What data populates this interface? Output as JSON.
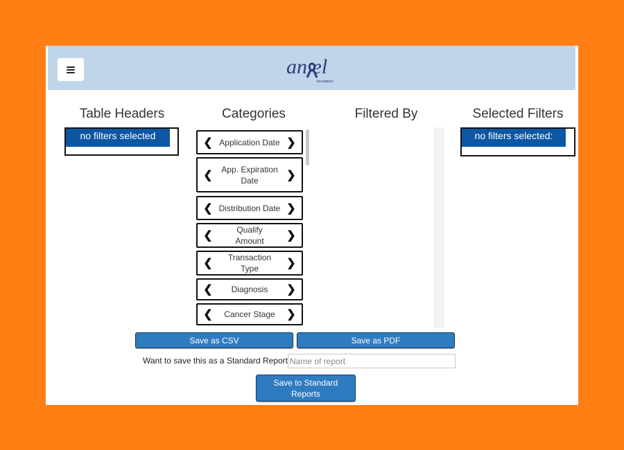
{
  "header": {
    "menu_icon": "hamburger-menu-icon",
    "logo_text": "an  el",
    "logo_sub": "foundation",
    "background": "#bfd6ea"
  },
  "columns": {
    "table_headers": {
      "title": "Table Headers",
      "empty_text": "no filters selected"
    },
    "categories": {
      "title": "Categories",
      "items": [
        {
          "label": "Application Date"
        },
        {
          "label": "App. Expiration Date"
        },
        {
          "label": "Distribution Date"
        },
        {
          "label": "Qualify Amount"
        },
        {
          "label": "Transaction Type"
        },
        {
          "label": "Diagnosis"
        },
        {
          "label": "Cancer Stage"
        }
      ]
    },
    "filtered_by": {
      "title": "Filtered By"
    },
    "selected_filters": {
      "title": "Selected Filters",
      "empty_text": "no filters selected:"
    }
  },
  "actions": {
    "save_csv": "Save as CSV",
    "save_pdf": "Save as PDF",
    "standard_prompt": "Want to save this as a Standard Report?",
    "report_name_placeholder": "Name of report",
    "report_name_value": "",
    "save_standard": "Save to Standard Reports"
  },
  "colors": {
    "page_border": "#ff7f14",
    "accent_blue": "#0b57a4",
    "button_blue": "#2f7bc0"
  }
}
